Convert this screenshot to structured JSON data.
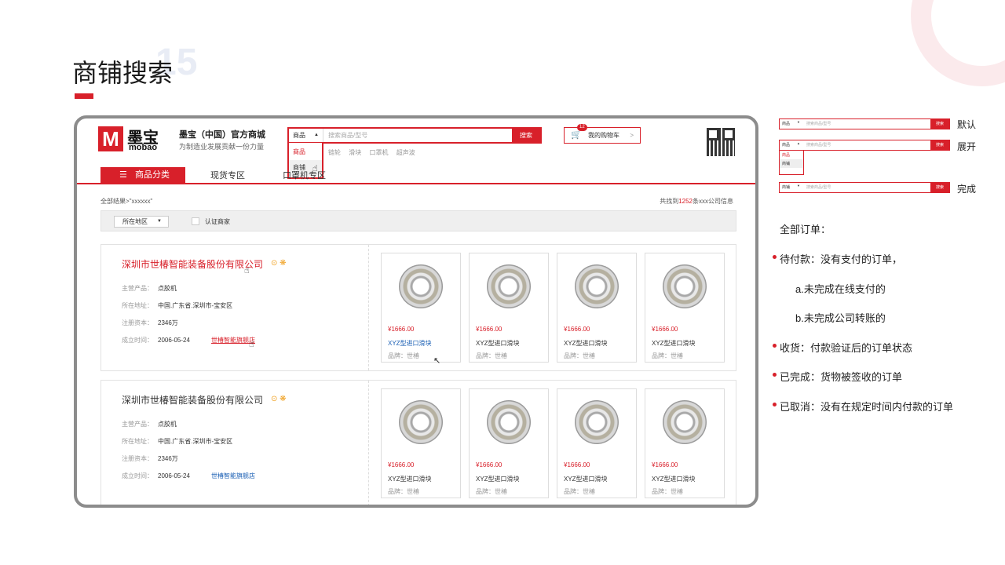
{
  "slide": {
    "title": "商铺搜索",
    "page_number": "15",
    "accent_color": "#d8202a"
  },
  "site": {
    "logo_letter": "M",
    "logo_cn": "墨宝",
    "logo_en": "mobao",
    "brand_title": "墨宝（中国）官方商城",
    "brand_subtitle": "为制造业发展贡献一份力量"
  },
  "search": {
    "selected_type": "商品",
    "placeholder": "搜索商品/型号",
    "button": "搜索",
    "dropdown_options": [
      "商品",
      "商铺"
    ],
    "hot_keywords": [
      "链轮",
      "滑块",
      "口罩机",
      "超声波"
    ]
  },
  "cart": {
    "badge": "12",
    "label": "我的购物车",
    "arrow": ">",
    "icon": "cart-icon"
  },
  "nav": {
    "category": "商品分类",
    "items": [
      "现货专区",
      "口罩机专区"
    ]
  },
  "results": {
    "breadcrumb": "全部结果>\"xxxxxx\"",
    "total_prefix": "共找到",
    "total_count": "1252",
    "total_suffix": "条xxx公司信息",
    "region_filter": "所在地区",
    "verified_label": "认证商家"
  },
  "stores": [
    {
      "name": "深圳市世椿智能装备股份有限公司",
      "main_product_label": "主营产品：",
      "main_product": "点胶机",
      "location_label": "所在地址：",
      "location": "中国.广东省.深圳市-宝安区",
      "capital_label": "注册资本：",
      "capital": "2346万",
      "founded_label": "成立时间：",
      "founded": "2006-05-24",
      "shop_link": "世椿智能旗舰店",
      "products": [
        {
          "price": "¥1666.00",
          "name": "XYZ型进口滑块",
          "brand": "品牌：世椿"
        },
        {
          "price": "¥1666.00",
          "name": "XYZ型进口滑块",
          "brand": "品牌：世椿"
        },
        {
          "price": "¥1666.00",
          "name": "XYZ型进口滑块",
          "brand": "品牌：世椿"
        },
        {
          "price": "¥1666.00",
          "name": "XYZ型进口滑块",
          "brand": "品牌：世椿"
        }
      ]
    },
    {
      "name": "深圳市世椿智能装备股份有限公司",
      "main_product_label": "主营产品：",
      "main_product": "点胶机",
      "location_label": "所在地址：",
      "location": "中国.广东省.深圳市-宝安区",
      "capital_label": "注册资本：",
      "capital": "2346万",
      "founded_label": "成立时间：",
      "founded": "2006-05-24",
      "shop_link": "世椿智能旗舰店",
      "products": [
        {
          "price": "¥1666.00",
          "name": "XYZ型进口滑块",
          "brand": "品牌：世椿"
        },
        {
          "price": "¥1666.00",
          "name": "XYZ型进口滑块",
          "brand": "品牌：世椿"
        },
        {
          "price": "¥1666.00",
          "name": "XYZ型进口滑块",
          "brand": "品牌：世椿"
        },
        {
          "price": "¥1666.00",
          "name": "XYZ型进口滑块",
          "brand": "品牌：世椿"
        }
      ]
    }
  ],
  "states": {
    "default": "默认",
    "expanded": "展开",
    "done": "完成",
    "mini_select_default": "商品",
    "mini_select_done": "商铺",
    "mini_placeholder": "搜索商品/型号",
    "mini_button": "搜索"
  },
  "notes": {
    "header": "全部订单：",
    "items": [
      "待付款：没有支付的订单，",
      "a.未完成在线支付的",
      "b.未完成公司转账的",
      "收货：付款验证后的订单状态",
      "已完成：货物被签收的订单",
      "已取消：没有在规定时间内付款的订单"
    ]
  }
}
